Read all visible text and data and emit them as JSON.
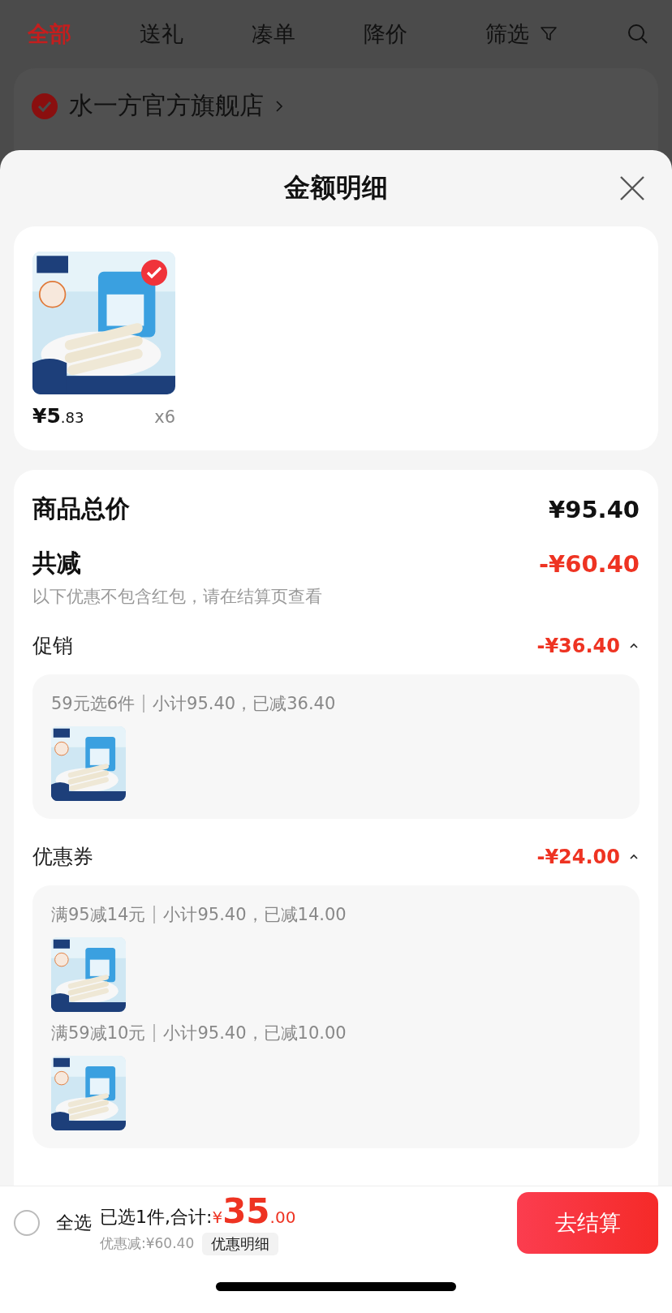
{
  "background": {
    "tabs": [
      {
        "label": "全部",
        "selected": true
      },
      {
        "label": "送礼",
        "selected": false
      },
      {
        "label": "凑单",
        "selected": false
      },
      {
        "label": "降价",
        "selected": false
      },
      {
        "label": "筛选",
        "selected": false,
        "kind": "filter"
      }
    ],
    "store": {
      "name": "水一方官方旗舰店",
      "verified": true
    }
  },
  "sheet": {
    "title": "金额明细",
    "product": {
      "selected": true,
      "price": "¥5",
      "price_cents": ".83",
      "quantity": "x6"
    },
    "summary": {
      "total_label": "商品总价",
      "total_value": "¥95.40",
      "reduce_label": "共减",
      "reduce_value": "-¥60.40",
      "note": "以下优惠不包含红包，请在结算页查看",
      "groups": [
        {
          "label": "促销",
          "amount": "-¥36.40",
          "expanded": true,
          "entries": [
            {
              "condition": "59元选6件",
              "detail": "小计95.40，已减36.40"
            }
          ]
        },
        {
          "label": "优惠券",
          "amount": "-¥24.00",
          "expanded": true,
          "entries": [
            {
              "condition": "满95减14元",
              "detail": "小计95.40，已减14.00"
            },
            {
              "condition": "满59减10元",
              "detail": "小计95.40，已减10.00"
            }
          ]
        }
      ]
    }
  },
  "footer": {
    "select_all": {
      "label": "全选",
      "checked": false
    },
    "selected_text": "已选1件,合计:",
    "currency": "¥",
    "total": "35",
    "total_cents": ".00",
    "discount": "优惠减:¥60.40",
    "details_button": "优惠明细",
    "checkout_button": "去结算"
  }
}
